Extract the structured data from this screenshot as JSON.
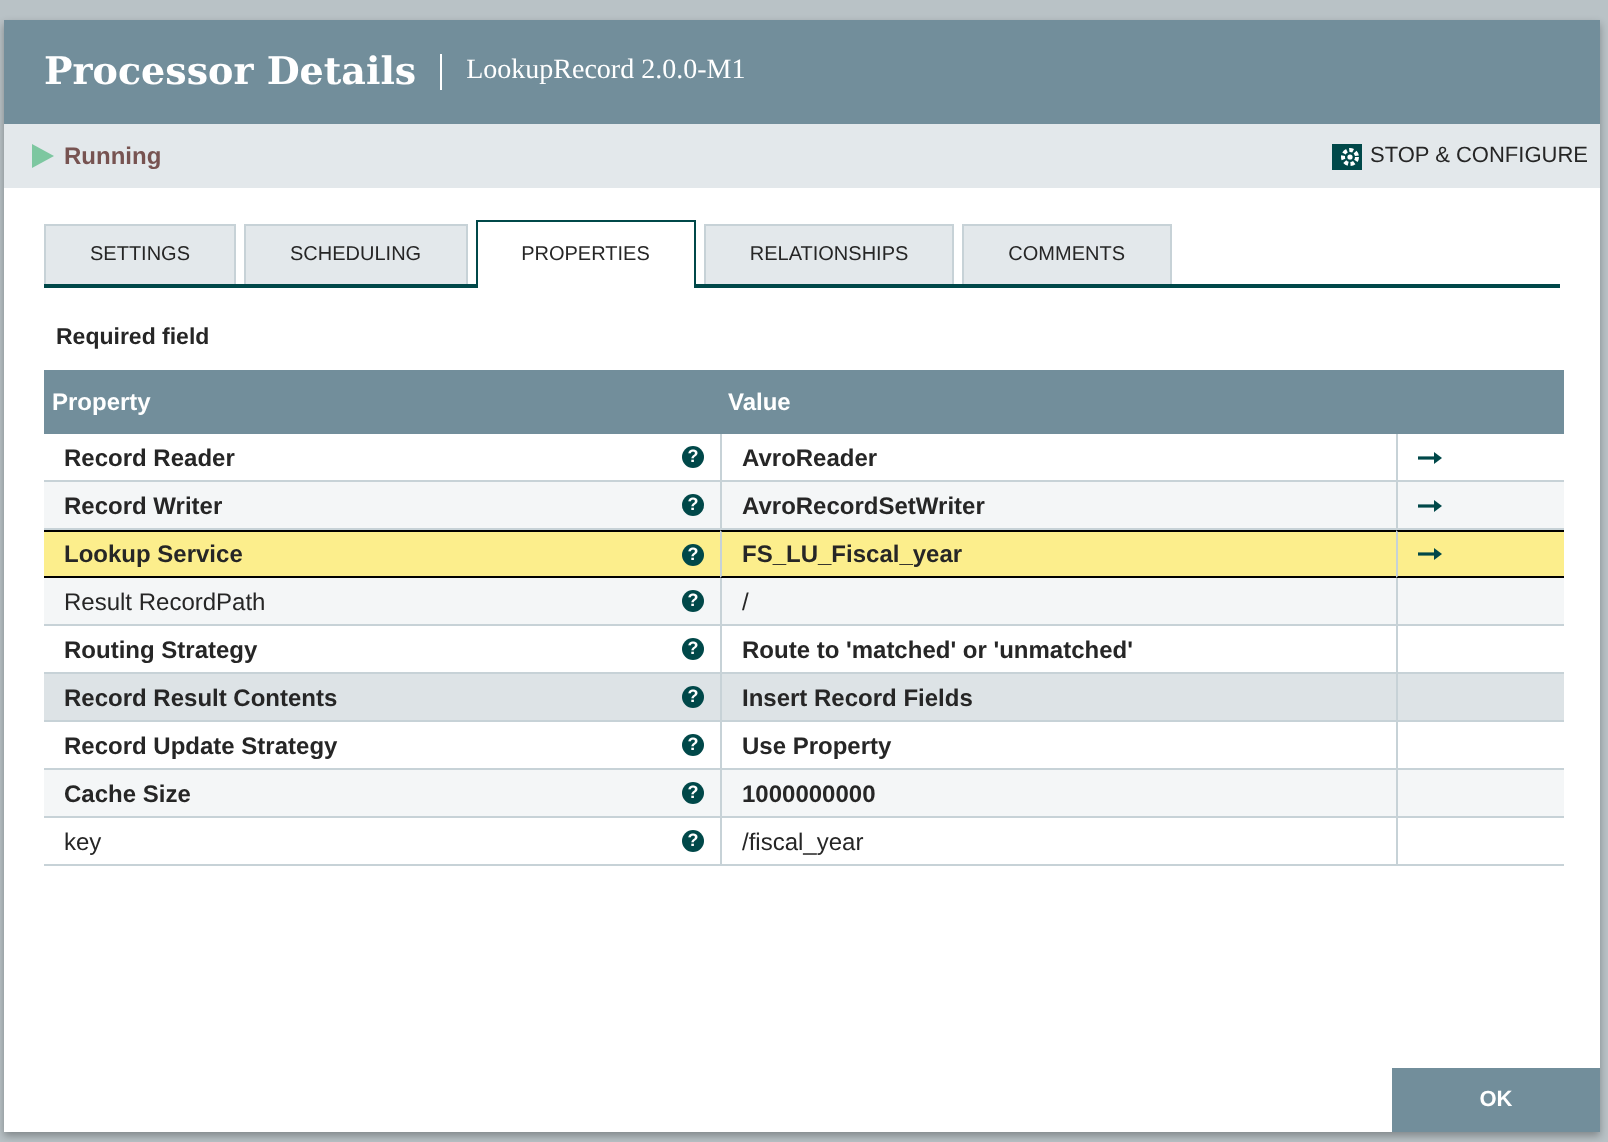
{
  "dialog": {
    "title": "Processor Details",
    "subtitle": "LookupRecord 2.0.0-M1"
  },
  "status": {
    "label": "Running",
    "action": "STOP & CONFIGURE"
  },
  "tabs": [
    {
      "label": "SETTINGS",
      "selected": false
    },
    {
      "label": "SCHEDULING",
      "selected": false
    },
    {
      "label": "PROPERTIES",
      "selected": true
    },
    {
      "label": "RELATIONSHIPS",
      "selected": false
    },
    {
      "label": "COMMENTS",
      "selected": false
    }
  ],
  "required_note": "Required field",
  "table": {
    "columns": [
      "Property",
      "Value"
    ],
    "rows": [
      {
        "property": "Record Reader",
        "value": "AvroReader",
        "help": "?",
        "required": true,
        "selected": false,
        "hovered": false,
        "has_link": true
      },
      {
        "property": "Record Writer",
        "value": "AvroRecordSetWriter",
        "help": "?",
        "required": true,
        "selected": false,
        "hovered": false,
        "has_link": true
      },
      {
        "property": "Lookup Service",
        "value": "FS_LU_Fiscal_year",
        "help": "?",
        "required": true,
        "selected": true,
        "hovered": false,
        "has_link": true
      },
      {
        "property": "Result RecordPath",
        "value": "/",
        "help": "?",
        "required": false,
        "selected": false,
        "hovered": false,
        "has_link": false
      },
      {
        "property": "Routing Strategy",
        "value": "Route to 'matched' or 'unmatched'",
        "help": "?",
        "required": true,
        "selected": false,
        "hovered": false,
        "has_link": false
      },
      {
        "property": "Record Result Contents",
        "value": "Insert Record Fields",
        "help": "?",
        "required": true,
        "selected": false,
        "hovered": true,
        "has_link": false
      },
      {
        "property": "Record Update Strategy",
        "value": "Use Property",
        "help": "?",
        "required": true,
        "selected": false,
        "hovered": false,
        "has_link": false
      },
      {
        "property": "Cache Size",
        "value": "1000000000",
        "help": "?",
        "required": true,
        "selected": false,
        "hovered": false,
        "has_link": false
      },
      {
        "property": "key",
        "value": "/fiscal_year",
        "help": "?",
        "required": false,
        "selected": false,
        "hovered": false,
        "has_link": false
      }
    ]
  },
  "buttons": [
    "OK"
  ]
}
